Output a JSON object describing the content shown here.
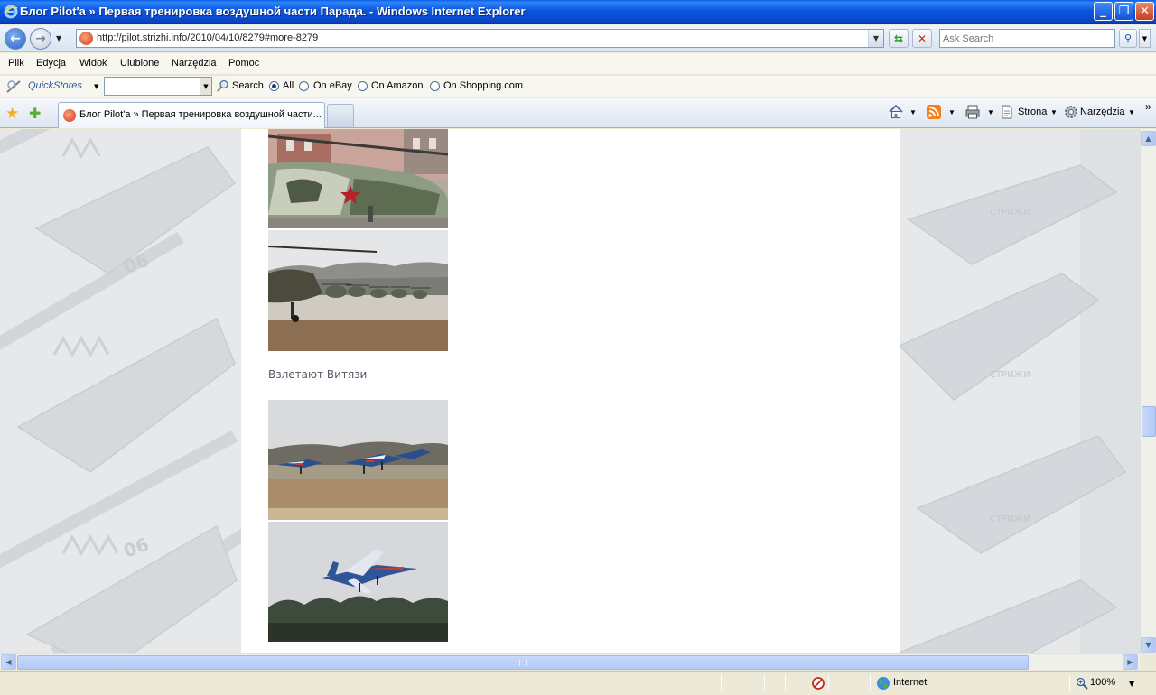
{
  "window": {
    "title": "Блог Pilot'a » Первая тренировка воздушной части Парада. - Windows Internet Explorer",
    "buttons": {
      "minimize": "_",
      "restore": "❐",
      "close": "✕"
    }
  },
  "address_bar": {
    "url": "http://pilot.strizhi.info/2010/04/10/8279#more-8279",
    "search_placeholder": "Ask Search"
  },
  "menu": [
    "Plik",
    "Edycja",
    "Widok",
    "Ulubione",
    "Narzędzia",
    "Pomoc"
  ],
  "quickstores": {
    "label": "QuickStores",
    "search_label": "Search",
    "options": [
      "All",
      "On eBay",
      "On Amazon",
      "On Shopping.com"
    ],
    "selected": "All"
  },
  "tabs": [
    {
      "label": "Блог Pilot'a » Первая тренировка воздушной части..."
    }
  ],
  "command_bar": {
    "page_label": "Strona",
    "tools_label": "Narzędzia"
  },
  "content": {
    "caption": "Взлетают Витязи",
    "photos": [
      "helicopter-closeup",
      "helicopters-lineup",
      "jets-taxiing",
      "jet-takeoff"
    ]
  },
  "status_bar": {
    "zone": "Internet",
    "zoom": "100%"
  },
  "colors": {
    "titlebar": "#0A4AD0",
    "caption_text": "#555A66",
    "page_bg": "#FFFFFF",
    "side_bg": "#E8EAEC"
  }
}
